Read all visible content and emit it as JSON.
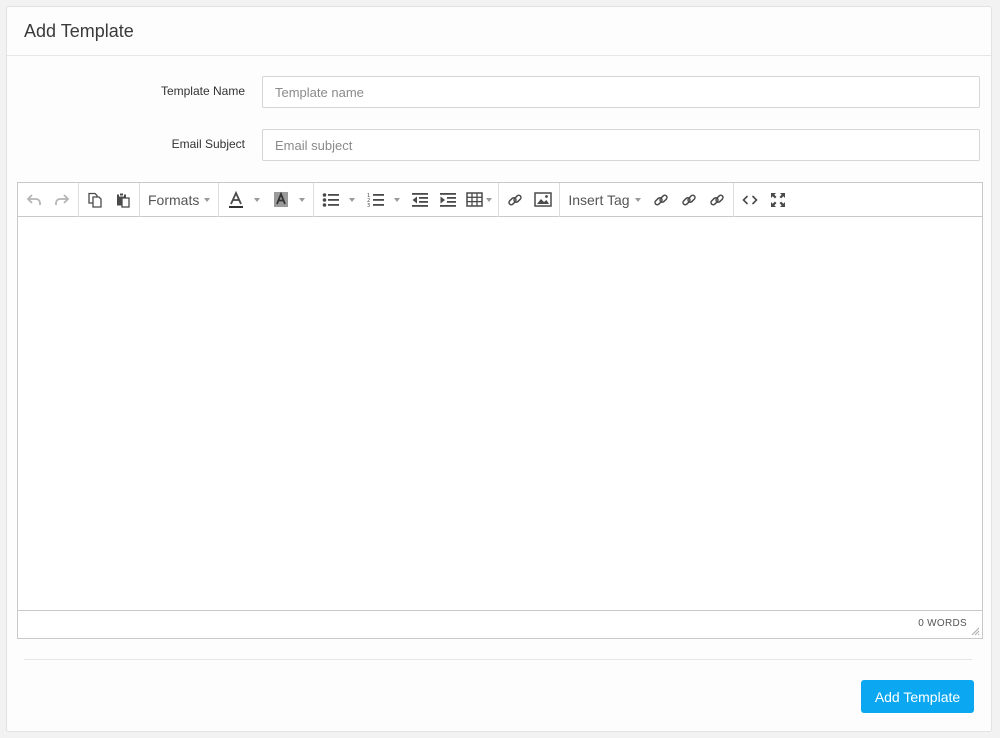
{
  "panel": {
    "title": "Add Template"
  },
  "form": {
    "template_name": {
      "label": "Template Name",
      "placeholder": "Template name",
      "value": ""
    },
    "email_subject": {
      "label": "Email Subject",
      "placeholder": "Email subject",
      "value": ""
    }
  },
  "editor": {
    "toolbar": {
      "formats_label": "Formats",
      "insert_tag_label": "Insert Tag",
      "icons": [
        "undo-icon",
        "redo-icon",
        "copy-icon",
        "paste-icon",
        "text-color-icon",
        "background-color-icon",
        "bullet-list-icon",
        "numbered-list-icon",
        "outdent-icon",
        "indent-icon",
        "table-icon",
        "link-icon",
        "image-icon",
        "link-icon",
        "link-icon",
        "link-icon",
        "source-code-icon",
        "fullscreen-icon"
      ]
    },
    "content": "",
    "word_count": "0 WORDS"
  },
  "actions": {
    "submit_label": "Add Template"
  },
  "colors": {
    "accent": "#0ba7f0",
    "border": "#c9c9c9",
    "background": "#f2f2f2"
  }
}
